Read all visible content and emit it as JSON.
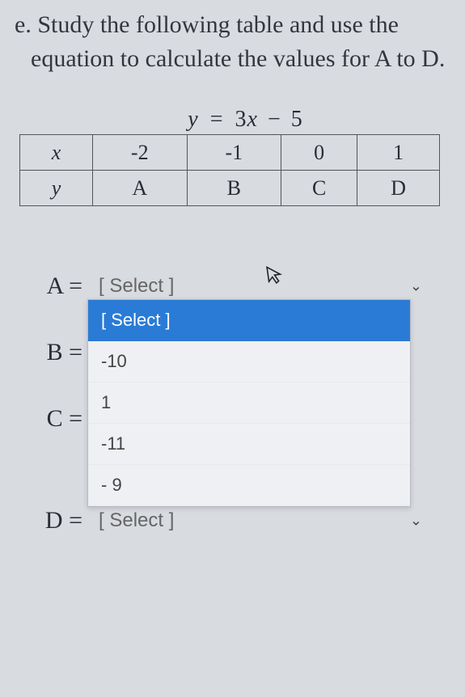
{
  "question": {
    "marker": "e.",
    "text": "Study the following table and use the equation to calculate the values for A to D."
  },
  "equation": {
    "lhs_var": "y",
    "eq": "=",
    "coef": "3",
    "rhs_var": "x",
    "op": "−",
    "const": "5"
  },
  "table": {
    "row_x_label": "x",
    "row_y_label": "y",
    "x": [
      "-2",
      "-1",
      "0",
      "1"
    ],
    "y": [
      "A",
      "B",
      "C",
      "D"
    ]
  },
  "answers": {
    "A": {
      "label": "A =",
      "value": "[ Select ]"
    },
    "B": {
      "label": "B =",
      "value": ""
    },
    "C": {
      "label": "C =",
      "value": ""
    },
    "D": {
      "label": "D =",
      "value": "[ Select ]"
    }
  },
  "dropdown": {
    "placeholder": "[ Select ]",
    "options": [
      "-10",
      "1",
      "-11",
      "- 9"
    ]
  },
  "icons": {
    "chevron": "⌄",
    "cursor": "↖"
  }
}
